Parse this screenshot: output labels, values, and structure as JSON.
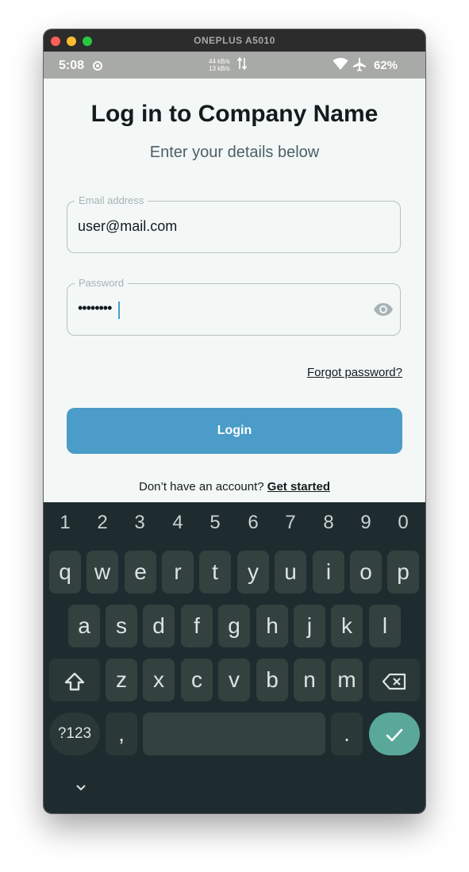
{
  "window": {
    "title": "ONEPLUS A5010"
  },
  "status_bar": {
    "time": "5:08",
    "speed_up": "44 kB/s",
    "speed_down": "13 kB/s",
    "battery": "62%"
  },
  "header": {
    "title": "Log in to Company Name",
    "subtitle": "Enter your details below"
  },
  "form": {
    "email_label": "Email address",
    "email_value": "user@mail.com",
    "password_label": "Password",
    "password_masked": "••••••••",
    "forgot_link": "Forgot password?",
    "login_button": "Login",
    "signup_prompt": "Don’t have an account?",
    "signup_link": "Get started"
  },
  "colors": {
    "accent": "#4b9cc8",
    "keyboard_bg": "#1f2c2f",
    "enter_key": "#5aa89a"
  },
  "keyboard": {
    "number_row": [
      "1",
      "2",
      "3",
      "4",
      "5",
      "6",
      "7",
      "8",
      "9",
      "0"
    ],
    "row1": [
      "q",
      "w",
      "e",
      "r",
      "t",
      "y",
      "u",
      "i",
      "o",
      "p"
    ],
    "row2": [
      "a",
      "s",
      "d",
      "f",
      "g",
      "h",
      "j",
      "k",
      "l"
    ],
    "row3": [
      "z",
      "x",
      "c",
      "v",
      "b",
      "n",
      "m"
    ],
    "symbols_key": "?123",
    "comma_key": ",",
    "period_key": ".",
    "icons": [
      "shift-icon",
      "backspace-icon",
      "check-icon",
      "chevron-down-icon"
    ]
  }
}
